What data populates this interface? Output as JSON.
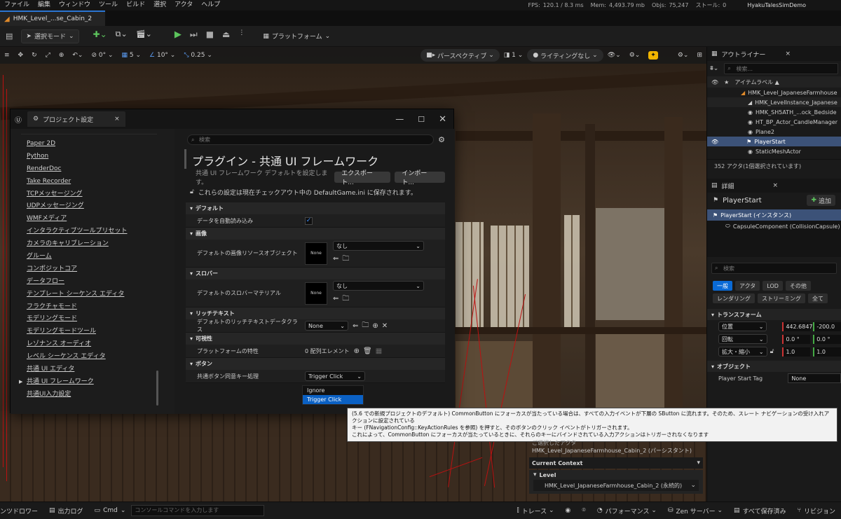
{
  "menu": {
    "items": [
      "ファイル",
      "編集",
      "ウィンドウ",
      "ツール",
      "ビルド",
      "選択",
      "アクタ",
      "ヘルプ"
    ],
    "stats": {
      "fps_label": "FPS:",
      "fps": "120.1 / 8.3 ms",
      "mem_label": "Mem:",
      "mem": "4,493.79 mb",
      "objs_label": "Objs:",
      "objs": "75,247",
      "stalls_label": "ストール:",
      "stalls": "0"
    },
    "project": "HyakuTalesSimDemo"
  },
  "tab": {
    "label": "HMK_Level_...se_Cabin_2"
  },
  "toolbar": {
    "mode": "選択モード",
    "platform": "プラットフォーム"
  },
  "viewport_toolbar": {
    "snap_rot": "0°",
    "grid": "5",
    "angle": "10°",
    "scale": "0.25",
    "perspective": "パースペクティブ",
    "cam_speed": "1",
    "lighting": "ライティングなし"
  },
  "outliner": {
    "title": "アウトライナー",
    "search_placeholder": "検索...",
    "column": "アイテムラベル ▲",
    "rows": [
      {
        "label": "HMK_Level_JapaneseFarmhouse",
        "selected": false
      },
      {
        "label": "HMK_LevelInstance_Japanese",
        "selected": false
      },
      {
        "label": "HMK_SH5ATH_...ock_Bedside",
        "selected": false
      },
      {
        "label": "HT_BP_Actor_CandleManager",
        "selected": false
      },
      {
        "label": "Plane2",
        "selected": false
      },
      {
        "label": "PlayerStart",
        "selected": true
      },
      {
        "label": "StaticMeshActor",
        "selected": false
      }
    ],
    "count": "352 アクタ(1個選択されています)"
  },
  "details": {
    "title": "詳細",
    "actor": "PlayerStart",
    "add_button": "追加",
    "instance": "PlayerStart (インスタンス)",
    "component": "CapsuleComponent (CollisionCapsule)",
    "search_placeholder": "検索",
    "filters_row1": [
      "一般",
      "アクタ",
      "LOD",
      "その他"
    ],
    "filters_row2": [
      "レンダリング",
      "ストリーミング",
      "全て"
    ],
    "transform_header": "トランスフォーム",
    "location_label": "位置",
    "location": [
      "442.6847",
      "-200.0"
    ],
    "rotation_label": "回転",
    "rotation": [
      "0.0 °",
      "0.0 °"
    ],
    "scale_label": "拡大・縮小",
    "scale": [
      "1.0",
      "1.0"
    ],
    "object_header": "オブジェクト",
    "tag_label": "Player Start Tag",
    "tag_value": "None"
  },
  "project_settings": {
    "window_title": "プロジェクト設定",
    "search_placeholder": "検索",
    "sidebar": [
      "Paper 2D",
      "Python",
      "RenderDoc",
      "Take Recorder",
      "TCPメッセージング",
      "UDPメッセージング",
      "WMFメディア",
      "インタラクティブツールプリセット",
      "カメラのキャリブレーション",
      "グルーム",
      "コンポジットコア",
      "データフロー",
      "テンプレート シーケンス エディタ",
      "フラクチャモード",
      "モデリングモード",
      "モデリングモードツール",
      "レゾナンス オーディオ",
      "レベル シーケンス エディタ",
      "共通 UI エディタ",
      "共通 UI フレームワーク",
      "共通UI入力設定"
    ],
    "active_index": 19,
    "heading": "プラグイン - 共通 UI フレームワーク",
    "subheading": "共通 UI フレームワーク デフォルトを設定します。",
    "export_button": "エクスポート...",
    "import_button": "インポート...",
    "save_note": "これらの設定は現在チェックアウト中の DefaultGame.ini に保存されます。",
    "sections": {
      "default": "デフォルト",
      "auto_load": "データを自動読み込み",
      "image": "画像",
      "image_row": "デフォルトの画像リソースオブジェクト",
      "none_combo": "なし",
      "thumb": "None",
      "throbber": "スロバー",
      "throbber_row": "デフォルトのスロバーマテリアル",
      "rich_text": "リッチテキスト",
      "rich_text_row": "デフォルトのリッチテキストデータクラス",
      "rich_text_value": "None",
      "visibility": "可視性",
      "platform_row": "プラットフォームの特性",
      "platform_value": "0 配列エレメント",
      "button": "ボタン",
      "confirm_row": "共通ボタン同意キー処理",
      "confirm_value": "Trigger Click"
    },
    "dropdown_options": [
      "Ignore",
      "Trigger Click"
    ],
    "dropdown_selected": 1
  },
  "tooltip": {
    "line1": "(5.6 での新規プロジェクトのデフォルト) CommonButton にフォーカスが当たっている場合は、すべての入力イベントが下層の SButton に流れます。そのため、スレート ナビゲーションの受け入れア",
    "line2": "クションに設定されている",
    "line3": "キー (FNavigationConfig::KeyActionRules を参照) を押すと、そのボタンのクリック イベントがトリガーされます。",
    "line4": "これによって、CommonButton にフォーカスが当たっているときに、それらのキーにバインドされている入力アクションはトリガーされなくなります"
  },
  "context": {
    "selected_label": "ご選択したアクタ",
    "selected_value": "HMK_Level_JapaneseFarmhouse_Cabin_2 (パーシスタント)",
    "current_context": "Current Context",
    "level_label": "Level",
    "level_value": "HMK_Level_JapaneseFarmhouse_Cabin_2 (永続的)"
  },
  "bottom": {
    "content_drawer": "ンツドロワー",
    "output_log": "出力ログ",
    "cmd": "Cmd",
    "cmd_placeholder": "コンソールコマンドを入力します",
    "trace": "トレース",
    "performance": "パフォーマンス",
    "zen": "Zen サーバー",
    "save_all": "すべて保存済み",
    "revision": "リビジョン"
  }
}
